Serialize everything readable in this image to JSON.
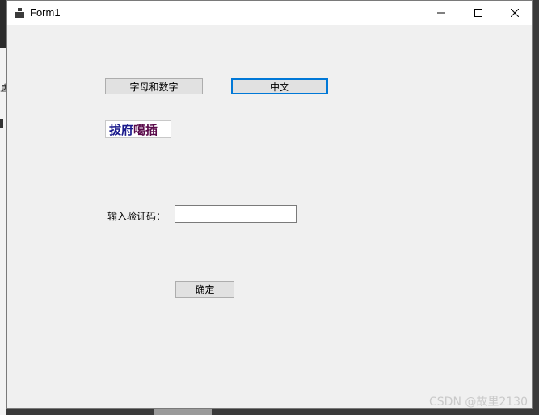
{
  "window": {
    "title": "Form1"
  },
  "buttons": {
    "alnum_label": "字母和数字",
    "chinese_label": "中文",
    "ok_label": "确定"
  },
  "captcha": {
    "chars": [
      {
        "ch": "拔",
        "color": "#1a1a8c"
      },
      {
        "ch": "府",
        "color": "#1a1a8c"
      },
      {
        "ch": "噶",
        "color": "#5a0a4a"
      },
      {
        "ch": "插",
        "color": "#5a0a4a"
      }
    ]
  },
  "form": {
    "captcha_label": "输入验证码：",
    "captcha_input_value": ""
  },
  "watermark": "CSDN @故里2130",
  "icons": {
    "app": "app-icon",
    "minimize": "minimize-icon",
    "maximize": "maximize-icon",
    "close": "close-icon"
  },
  "colors": {
    "focus_border": "#0078d7",
    "form_background": "#f0f0f0"
  }
}
